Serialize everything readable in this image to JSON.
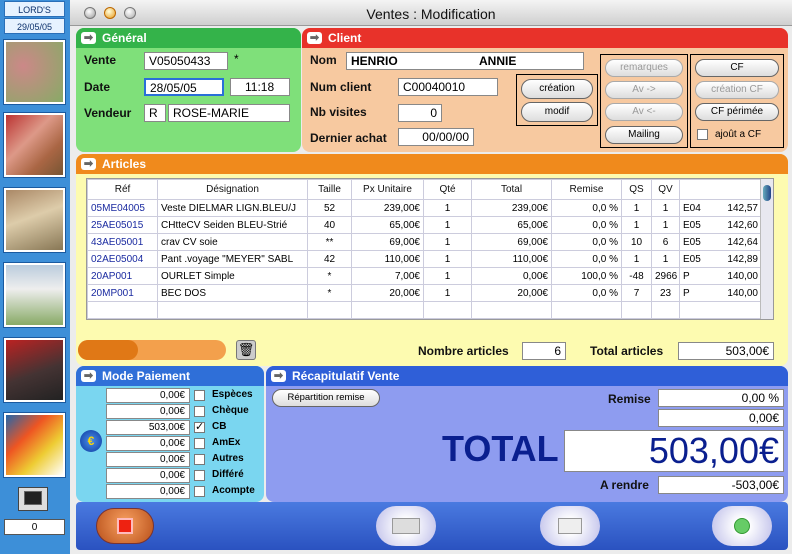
{
  "sidebar": {
    "brand": "LORD'S",
    "date": "29/05/05",
    "counter": "0"
  },
  "window": {
    "title": "Ventes : Modification"
  },
  "general": {
    "title": "Général",
    "vente_label": "Vente",
    "vente": "V05050433",
    "vente_mark": "*",
    "date_label": "Date",
    "date": "28/05/05",
    "time": "11:18",
    "vendeur_label": "Vendeur",
    "vendeur_code": "R",
    "vendeur_name": "ROSE-MARIE"
  },
  "client": {
    "title": "Client",
    "nom_label": "Nom",
    "nom": "HENRIO",
    "prenom": "ANNIE",
    "num_label": "Num client",
    "num": "C00040010",
    "visites_label": "Nb visites",
    "visites": "0",
    "achat_label": "Dernier achat",
    "achat": "00/00/00",
    "btn_creation": "création",
    "btn_modif": "modif",
    "btn_remarques": "remarques",
    "btn_av1": "Av ->",
    "btn_av2": "Av <-",
    "btn_mailing": "Mailing",
    "btn_cf": "CF",
    "btn_creation_cf": "création CF",
    "btn_cf_perimee": "CF périmée",
    "ajout_cf": "ajoût a CF"
  },
  "articles": {
    "title": "Articles",
    "headers": [
      "Réf",
      "Désignation",
      "Taille",
      "Px Unitaire",
      "Qté",
      "Total",
      "Remise",
      "QS",
      "QV",
      ""
    ],
    "rows": [
      [
        "05ME04005",
        "Veste DIELMAR LIGN.BLEU/J",
        "52",
        "239,00€",
        "1",
        "239,00€",
        "0,0 %",
        "1",
        "1",
        "E04",
        "142,57"
      ],
      [
        "25AE05015",
        "CHtteCV Seiden BLEU-Strié",
        "40",
        "65,00€",
        "1",
        "65,00€",
        "0,0 %",
        "1",
        "1",
        "E05",
        "142,60"
      ],
      [
        "43AE05001",
        "crav CV soie",
        "**",
        "69,00€",
        "1",
        "69,00€",
        "0,0 %",
        "10",
        "6",
        "E05",
        "142,64"
      ],
      [
        "02AE05004",
        "Pant .voyage \"MEYER\" SABL",
        "42",
        "110,00€",
        "1",
        "110,00€",
        "0,0 %",
        "1",
        "1",
        "E05",
        "142,89"
      ],
      [
        "20AP001",
        "OURLET Simple",
        "*",
        "7,00€",
        "1",
        "0,00€",
        "100,0 %",
        "-48",
        "2966",
        "P",
        "140,00"
      ],
      [
        "20MP001",
        "BEC DOS",
        "*",
        "20,00€",
        "1",
        "20,00€",
        "0,0 %",
        "7",
        "23",
        "P",
        "140,00"
      ]
    ],
    "nb_label": "Nombre articles",
    "nb": "6",
    "total_label": "Total articles",
    "total": "503,00€"
  },
  "paiement": {
    "title": "Mode Paiement",
    "modes": [
      {
        "amount": "0,00€",
        "label": "Espèces",
        "checked": ""
      },
      {
        "amount": "0,00€",
        "label": "Chèque",
        "checked": ""
      },
      {
        "amount": "503,00€",
        "label": "CB",
        "checked": "✓"
      },
      {
        "amount": "0,00€",
        "label": "AmEx",
        "checked": ""
      },
      {
        "amount": "0,00€",
        "label": "Autres",
        "checked": ""
      },
      {
        "amount": "0,00€",
        "label": "Différé",
        "checked": ""
      },
      {
        "amount": "0,00€",
        "label": "Acompte",
        "checked": ""
      }
    ],
    "euro": "€"
  },
  "recap": {
    "title": "Récapitulatif Vente",
    "repartition": "Répartition remise",
    "remise_label": "Remise",
    "remise_pct": "0,00 %",
    "remise_amt": "0,00€",
    "total_label": "TOTAL",
    "total": "503,00€",
    "rendre_label": "A rendre",
    "rendre": "-503,00€"
  },
  "colors": {
    "green": "#34b34a",
    "red": "#e8322a",
    "orange": "#f08a1c",
    "blue": "#2f5fd8",
    "light_yellow": "#fdfbb0",
    "accent_navy": "#0a1f8f"
  }
}
